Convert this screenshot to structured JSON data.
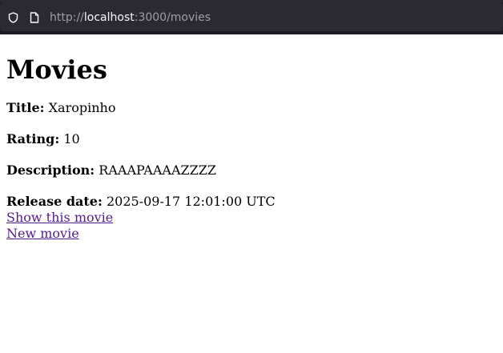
{
  "browser": {
    "url_scheme": "http://",
    "url_host": "localhost",
    "url_rest": ":3000/movies"
  },
  "page": {
    "title": "Movies",
    "movie": {
      "title_label": "Title:",
      "title_value": "Xaropinho",
      "rating_label": "Rating:",
      "rating_value": "10",
      "description_label": "Description:",
      "description_value": "RAAAPAAAAZZZZ",
      "release_label": "Release date:",
      "release_value": "2025-09-17 12:01:00 UTC"
    },
    "show_link": "Show this movie",
    "new_link": "New movie"
  },
  "colors": {
    "toolbar_bg": "#1c1b22",
    "url_field_bg": "#2b2a33",
    "link_visited": "#551a8b"
  },
  "icons": [
    "shield-icon",
    "page-icon"
  ]
}
